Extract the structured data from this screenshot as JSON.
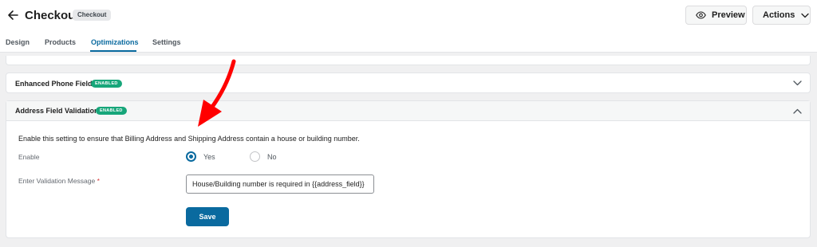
{
  "header": {
    "title": "Checkout",
    "badge": "Checkout",
    "preview_label": "Preview",
    "actions_label": "Actions"
  },
  "tabs": [
    {
      "label": "Design",
      "active": false
    },
    {
      "label": "Products",
      "active": false
    },
    {
      "label": "Optimizations",
      "active": true
    },
    {
      "label": "Settings",
      "active": false
    }
  ],
  "panels": {
    "phone": {
      "title": "Enhanced Phone Field",
      "badge": "ENABLED",
      "expanded": false
    },
    "address": {
      "title": "Address Field Validation",
      "badge": "ENABLED",
      "expanded": true,
      "description": "Enable this setting to ensure that Billing Address and Shipping Address contain a house or building number.",
      "enable_label": "Enable",
      "yes_label": "Yes",
      "no_label": "No",
      "selected": "Yes",
      "message_label": "Enter Validation Message",
      "required_mark": "*",
      "message_value": "House/Building number is required in {{address_field}}",
      "save_label": "Save"
    }
  },
  "colors": {
    "accent": "#0a6a9f",
    "enabled_badge": "#17a67a",
    "annotation_arrow": "#ff0000"
  },
  "icons": {
    "back": "arrow-left-icon",
    "preview": "eye-icon",
    "actions": "chevron-down-icon",
    "collapsed": "chevron-down-icon",
    "expanded": "chevron-up-icon",
    "annotation": "red-arrow-icon"
  }
}
